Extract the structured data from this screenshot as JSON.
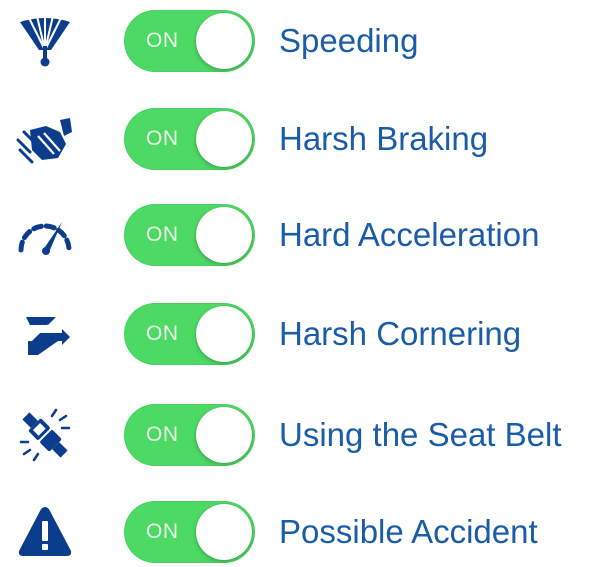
{
  "colors": {
    "accent": "#1a5ca8",
    "toggle_on": "#4cd964",
    "icon": "#0b3d8c"
  },
  "settings": [
    {
      "icon": "speedometer-bar-icon",
      "toggle": "ON",
      "label": "Speeding"
    },
    {
      "icon": "braking-foot-icon",
      "toggle": "ON",
      "label": "Harsh Braking"
    },
    {
      "icon": "speed-gauge-icon",
      "toggle": "ON",
      "label": "Hard Acceleration"
    },
    {
      "icon": "zigzag-turn-icon",
      "toggle": "ON",
      "label": "Harsh Cornering"
    },
    {
      "icon": "seatbelt-buckle-icon",
      "toggle": "ON",
      "label": "Using the Seat Belt"
    },
    {
      "icon": "warning-triangle-icon",
      "toggle": "ON",
      "label": "Possible Accident"
    }
  ]
}
